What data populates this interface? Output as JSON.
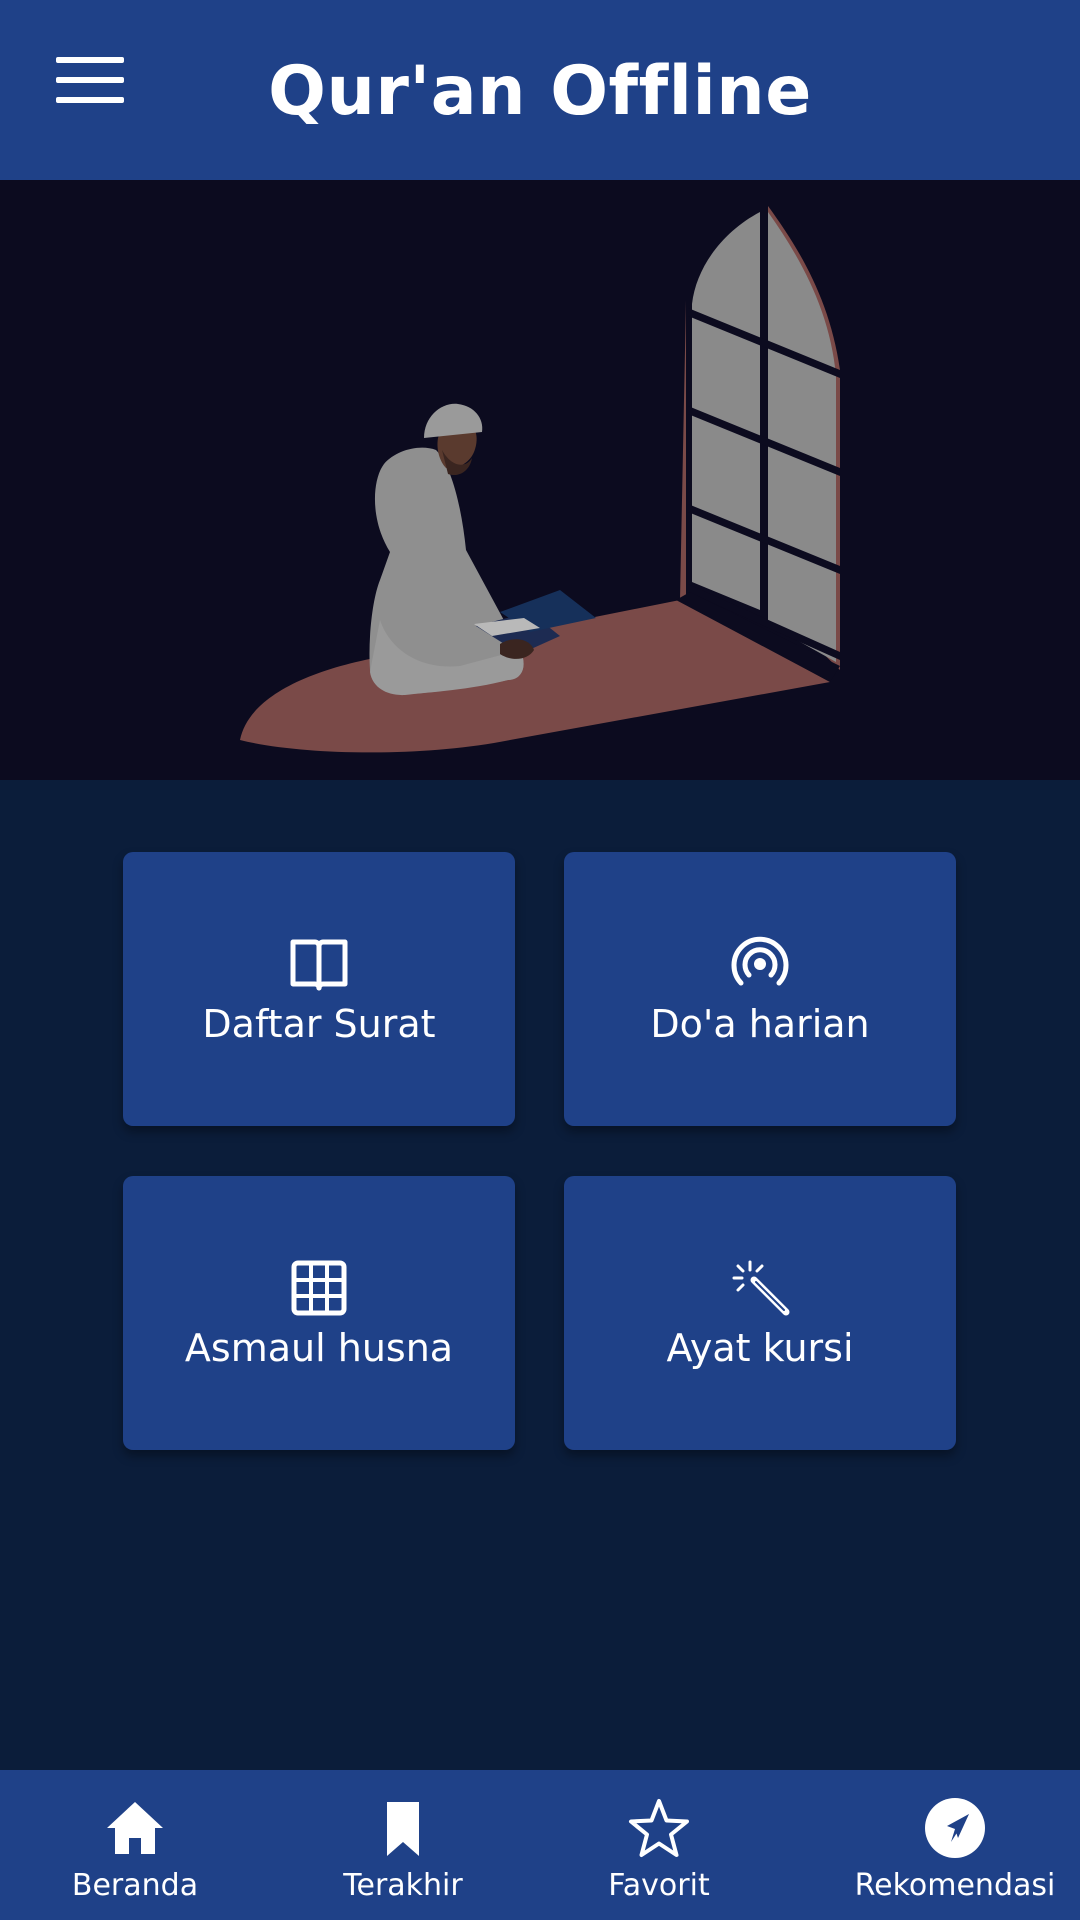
{
  "app": {
    "title": "Qur'an Offline"
  },
  "header": {
    "menu_icon": "hamburger-menu-icon"
  },
  "hero": {
    "illustration": "man-reading-quran-by-window"
  },
  "menu": {
    "items": [
      {
        "label": "Daftar Surat",
        "icon": "open-book-icon"
      },
      {
        "label": "Do'a harian",
        "icon": "broadcast-icon"
      },
      {
        "label": "Asmaul husna",
        "icon": "grid-icon"
      },
      {
        "label": "Ayat kursi",
        "icon": "magic-wand-icon"
      }
    ]
  },
  "bottom_nav": {
    "items": [
      {
        "label": "Beranda",
        "icon": "home-icon"
      },
      {
        "label": "Terakhir",
        "icon": "bookmark-icon"
      },
      {
        "label": "Favorit",
        "icon": "star-icon"
      },
      {
        "label": "Rekomendasi",
        "icon": "navigation-arrow-icon"
      }
    ]
  },
  "colors": {
    "app_bar": "#1f4188",
    "background": "#0b1d3a",
    "hero_background": "#0c0b1f",
    "card": "#1f4188",
    "text": "#ffffff"
  }
}
